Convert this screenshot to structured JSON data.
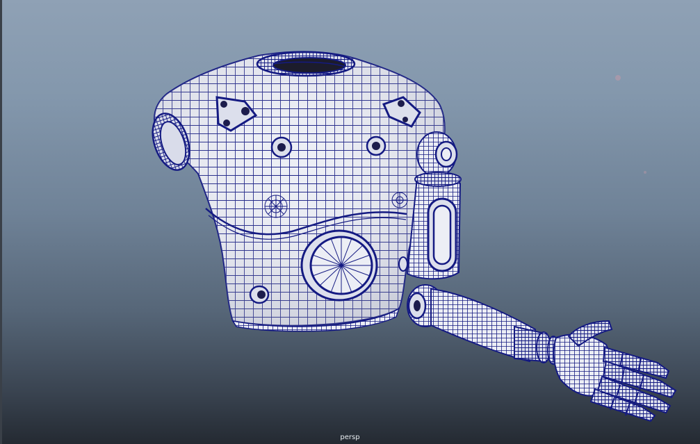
{
  "viewport": {
    "camera_name": "persp",
    "background_top": "#8fa1b5",
    "background_bottom": "#242a32"
  },
  "model": {
    "surface_color": "#eceef5",
    "wire_color": "#141a82",
    "shadow_color": "#c7cad6"
  }
}
